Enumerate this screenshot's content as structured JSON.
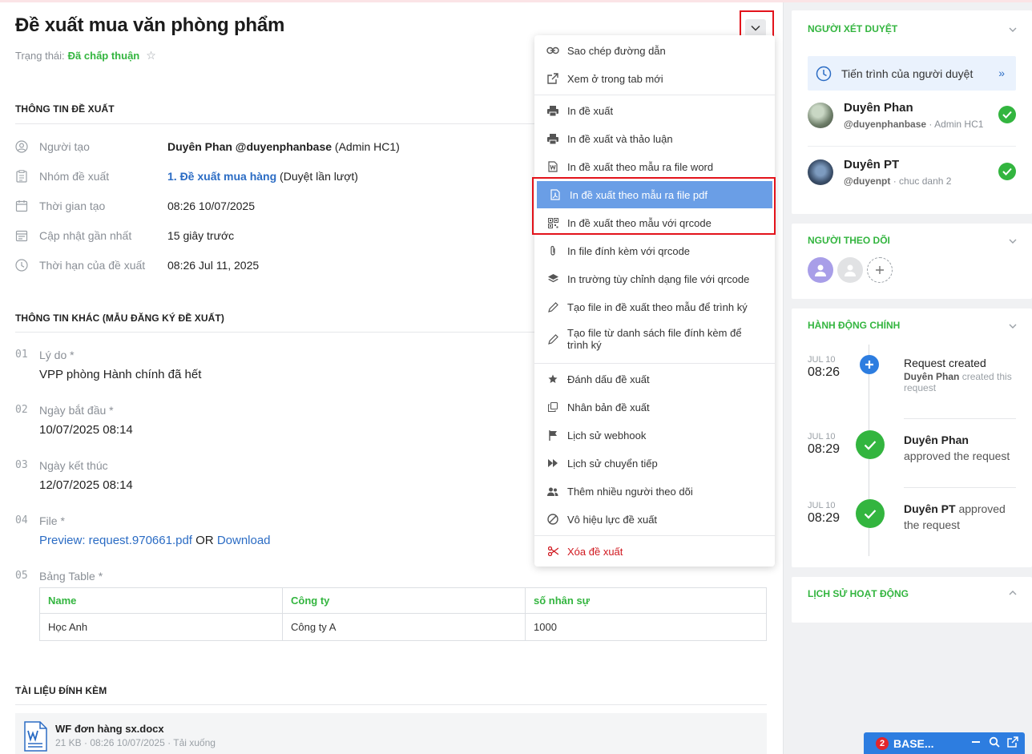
{
  "header": {
    "title": "Đề xuất mua văn phòng phẩm",
    "status_label": "Trạng thái:",
    "status_value": "Đã chấp thuận"
  },
  "sections": {
    "info_title": "THÔNG TIN ĐỀ XUẤT",
    "other_title": "THÔNG TIN KHÁC (MẪU ĐĂNG KÝ ĐỀ XUẤT)",
    "attach_title": "TÀI LIỆU ĐÍNH KÈM"
  },
  "info": {
    "creator_label": "Người tạo",
    "creator_name": "Duyên Phan @duyenphanbase",
    "creator_role": " (Admin HC1)",
    "group_label": "Nhóm đề xuất",
    "group_link": "1. Đề xuất mua hàng",
    "group_mode": " (Duyệt lần lượt)",
    "created_label": "Thời gian tạo",
    "created_value": "08:26 10/07/2025",
    "updated_label": "Cập nhật gần nhất",
    "updated_value": "15 giây trước",
    "deadline_label": "Thời hạn của đề xuất",
    "deadline_value": "08:26 Jul 11, 2025"
  },
  "fields": [
    {
      "num": "01",
      "label": "Lý do *",
      "value": "VPP phòng Hành chính đã hết"
    },
    {
      "num": "02",
      "label": "Ngày bắt đầu *",
      "value": "10/07/2025 08:14"
    },
    {
      "num": "03",
      "label": "Ngày kết thúc",
      "value": "12/07/2025 08:14"
    },
    {
      "num": "04",
      "label": "File *",
      "preview": "Preview: request.970661.pdf",
      "or": " OR ",
      "download": "Download"
    },
    {
      "num": "05",
      "label": "Bảng Table *"
    }
  ],
  "table": {
    "headers": [
      "Name",
      "Công ty",
      "số nhân sự"
    ],
    "rows": [
      [
        "Học Anh",
        "Công ty A",
        "1000"
      ]
    ]
  },
  "attachment": {
    "name": "WF đơn hàng sx.docx",
    "meta": "21 KB · 08:26 10/07/2025 · ",
    "download": "Tải xuống"
  },
  "menu": {
    "items": [
      "Sao chép đường dẫn",
      "Xem ở trong tab mới",
      "In đề xuất",
      "In đề xuất và thảo luận",
      "In đề xuất theo mẫu ra file word",
      "In đề xuất theo mẫu ra file pdf",
      "In đề xuất theo mẫu với qrcode",
      "In file đính kèm với qrcode",
      "In trường tùy chỉnh dạng file với qrcode",
      "Tạo file in đề xuất theo mẫu để trình ký",
      "Tạo file từ danh sách file đính kèm để trình ký",
      "Đánh dấu đề xuất",
      "Nhân bản đề xuất",
      "Lịch sử webhook",
      "Lịch sử chuyển tiếp",
      "Thêm nhiều người theo dõi",
      "Vô hiệu lực đề xuất",
      "Xóa đề xuất"
    ],
    "active_index": 5
  },
  "approvers": {
    "title": "NGƯỜI XÉT DUYỆT",
    "progress_label": "Tiến trình của người duyệt",
    "list": [
      {
        "name": "Duyên Phan",
        "handle": "@duyenphanbase",
        "role": " · Admin HC1"
      },
      {
        "name": "Duyên PT",
        "handle": "@duyenpt",
        "role": " · chuc danh 2"
      }
    ]
  },
  "followers": {
    "title": "NGƯỜI THEO DÕI"
  },
  "actions": {
    "title": "HÀNH ĐỘNG CHÍNH",
    "items": [
      {
        "date": "JUL 10",
        "time": "08:26",
        "title": "Request created",
        "actor": "Duyên Phan",
        "rest": " created this request"
      },
      {
        "date": "JUL 10",
        "time": "08:29",
        "actor": "Duyên Phan",
        "rest": "approved the request"
      },
      {
        "date": "JUL 10",
        "time": "08:29",
        "actor": "Duyên PT",
        "rest": " approved the request"
      }
    ]
  },
  "history": {
    "title": "LỊCH SỬ HOẠT ĐỘNG"
  },
  "chat": {
    "badge": "2",
    "label": "BASE..."
  },
  "colors": {
    "accent_green": "#33b53f",
    "link_blue": "#2b6cc4",
    "menu_active": "#6a9ee6",
    "danger": "#d0181f",
    "highlight_red": "#e3131b"
  }
}
